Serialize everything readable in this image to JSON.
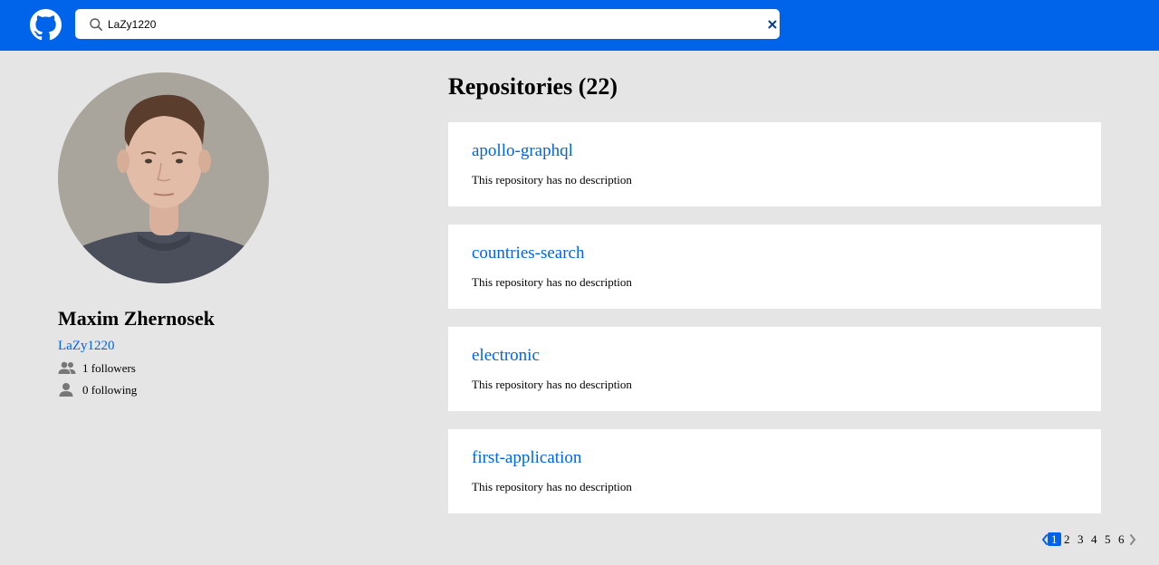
{
  "search": {
    "value": "LaZy1220",
    "placeholder": ""
  },
  "user": {
    "name": "Maxim Zhernosek",
    "login": "LaZy1220",
    "followers": "1 followers",
    "following": "0 following"
  },
  "repositories": {
    "title": "Repositories (22)",
    "items": [
      {
        "name": "apollo-graphql",
        "description": "This repository has no description"
      },
      {
        "name": "countries-search",
        "description": "This repository has no description"
      },
      {
        "name": "electronic",
        "description": "This repository has no description"
      },
      {
        "name": "first-application",
        "description": "This repository has no description"
      }
    ]
  },
  "pagination": {
    "pages": [
      "1",
      "2",
      "3",
      "4",
      "5",
      "6"
    ],
    "current": "1"
  },
  "colors": {
    "accent": "#0064eb",
    "background": "#e5e5e5",
    "card": "#ffffff"
  },
  "icons": {
    "logo": "github-logo-icon",
    "search": "search-icon",
    "clear": "close-icon",
    "followers": "people-icon",
    "following": "person-icon",
    "prev": "chevron-left-icon",
    "next": "chevron-right-icon"
  }
}
